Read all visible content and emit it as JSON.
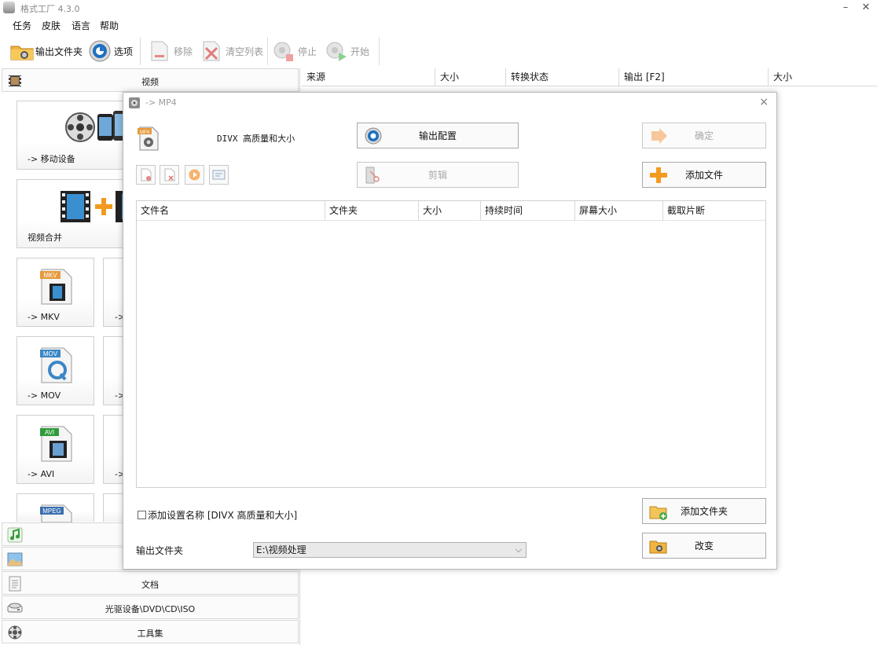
{
  "window": {
    "title": "格式工厂 4.3.0",
    "minimize": "–",
    "close": "✕"
  },
  "menu": [
    "任务",
    "皮肤",
    "语言",
    "帮助"
  ],
  "toolbar": {
    "output_folder": "输出文件夹",
    "options": "选项",
    "remove": "移除",
    "clear_list": "清空列表",
    "stop": "停止",
    "start": "开始"
  },
  "left": {
    "video_header": "视频",
    "tiles": {
      "mobile": "-> 移动设备",
      "merge": "视频合并",
      "mkv": "-> MKV",
      "mkv_badge": "MKV",
      "mov": "-> MOV",
      "mov_badge": "MOV",
      "avi": "-> AVI",
      "avi_badge": "AVI",
      "mpeg_badge": "MPEG",
      "partial": "->"
    },
    "categories": {
      "doc": "文档",
      "disc": "光驱设备\\DVD\\CD\\ISO",
      "tools": "工具集"
    }
  },
  "list_header": [
    "来源",
    "大小",
    "转换状态",
    "输出 [F2]",
    "大小"
  ],
  "dialog": {
    "title": "-> MP4",
    "close": "×",
    "format_badge": "MP4",
    "profile": "DIVX 高质量和大小",
    "output_config": "输出配置",
    "confirm": "确定",
    "clip": "剪辑",
    "add_file": "添加文件",
    "columns": [
      "文件名",
      "文件夹",
      "大小",
      "持续时间",
      "屏幕大小",
      "截取片断"
    ],
    "add_setting_name": "添加设置名称 [DIVX 高质量和大小]",
    "add_folder": "添加文件夹",
    "output_folder_label": "输出文件夹",
    "output_folder_value": "E:\\视频处理",
    "change": "改变"
  },
  "colors": {
    "accent_orange": "#f39a1e",
    "disabled_text": "#a8a8a8",
    "border": "#a9a9a9"
  }
}
